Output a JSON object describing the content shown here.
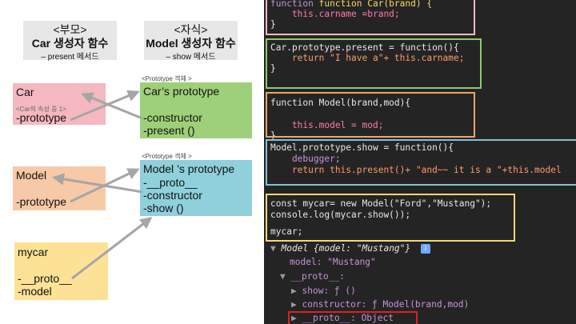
{
  "left": {
    "parent_header": {
      "line1": "<부모>",
      "line2": "Car 생성자 함수",
      "line3": "– present 메서드"
    },
    "child_header": {
      "line1": "<자식>",
      "line2": "Model 생성자 함수",
      "line3": "– show 메서드"
    },
    "car": {
      "title": "Car",
      "note": "<Car의 속성 중 1>",
      "prop": "-prototype"
    },
    "car_proto": {
      "caption": "<Prototype 객체 >",
      "title": "Car’s prototype",
      "lines": [
        "-constructor",
        "-present ()"
      ]
    },
    "model": {
      "title": "Model",
      "prop": "-prototype"
    },
    "model_proto": {
      "caption": "<Prototype 객체 >",
      "title": "Model ’s prototype",
      "lines": [
        "-__proto__",
        "-constructor",
        "-show ()"
      ]
    },
    "mycar": {
      "title": "mycar",
      "lines": [
        "-__proto__",
        "-model"
      ]
    }
  },
  "code": {
    "block1": [
      "function Car(brand) {",
      "    this.carname =brand;",
      "}"
    ],
    "block2": [
      "Car.prototype.present = function(){",
      "    return \"I have a\"+ this.carname;",
      "}"
    ],
    "block3": [
      "function Model(brand,mod){",
      "",
      "    this.model = mod;",
      "}"
    ],
    "block4": [
      "Model.prototype.show = function(){",
      "    debugger;",
      "    return this.present()+ \"and~~ it is a \"+this.model"
    ],
    "block5": [
      "const mycar= new Model(\"Ford\",\"Mustang\");",
      "console.log(mycar.show());"
    ],
    "block6": [
      "mycar;"
    ],
    "console": {
      "obj_line": "Model {model: \"Mustang\"}",
      "info_badge": "i",
      "model_line": "model: \"Mustang\"",
      "proto_line": "__proto__:",
      "show_line": "show: ƒ ()",
      "ctor_line": "constructor: ƒ Model(brand,mod)",
      "proto2_line": "__proto__: Object"
    }
  },
  "colors": {
    "pink": "#f5b8c0",
    "green": "#9ed07a",
    "orange": "#f8c9a7",
    "cyan": "#8fd0db",
    "yellow": "#fde296",
    "grey": "#e7e7e7",
    "frame_pink": "#f3b6c6",
    "frame_green": "#8fc96a",
    "frame_orange": "#f2a46a",
    "frame_cyan": "#7fc4d9",
    "frame_yellow": "#f6d873",
    "frame_red": "#e02020"
  }
}
